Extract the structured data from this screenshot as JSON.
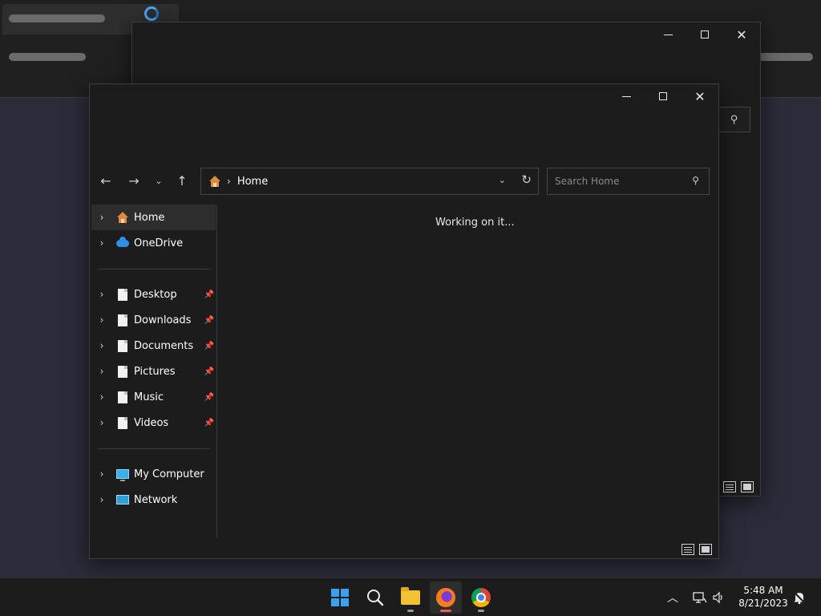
{
  "explorer": {
    "address_path": "Home",
    "search_placeholder": "Search Home",
    "status_text": "Working on it...",
    "sidebar": {
      "top_items": [
        {
          "label": "Home",
          "icon": "home-icon",
          "selected": true
        },
        {
          "label": "OneDrive",
          "icon": "cloud-icon",
          "selected": false
        }
      ],
      "quick_access": [
        {
          "label": "Desktop",
          "icon": "document-icon",
          "pinned": true
        },
        {
          "label": "Downloads",
          "icon": "document-icon",
          "pinned": true
        },
        {
          "label": "Documents",
          "icon": "document-icon",
          "pinned": true
        },
        {
          "label": "Pictures",
          "icon": "document-icon",
          "pinned": true
        },
        {
          "label": "Music",
          "icon": "document-icon",
          "pinned": true
        },
        {
          "label": "Videos",
          "icon": "document-icon",
          "pinned": true
        }
      ],
      "devices": [
        {
          "label": "My Computer",
          "icon": "computer-icon"
        },
        {
          "label": "Network",
          "icon": "network-icon"
        }
      ]
    }
  },
  "taskbar": {
    "apps": [
      {
        "name": "start",
        "icon": "windows-logo-icon"
      },
      {
        "name": "search",
        "icon": "search-icon"
      },
      {
        "name": "file-explorer",
        "icon": "folder-icon",
        "running": true
      },
      {
        "name": "firefox",
        "icon": "firefox-icon",
        "running": true,
        "active": true
      },
      {
        "name": "chrome",
        "icon": "chrome-icon",
        "running": true
      }
    ],
    "clock": {
      "time": "5:48 AM",
      "date": "8/21/2023"
    }
  },
  "colors": {
    "window_bg": "#1c1c1c",
    "desktop_bg": "#2c2c3a",
    "accent": "#3aa0f0",
    "active_indicator": "#e8605a"
  }
}
